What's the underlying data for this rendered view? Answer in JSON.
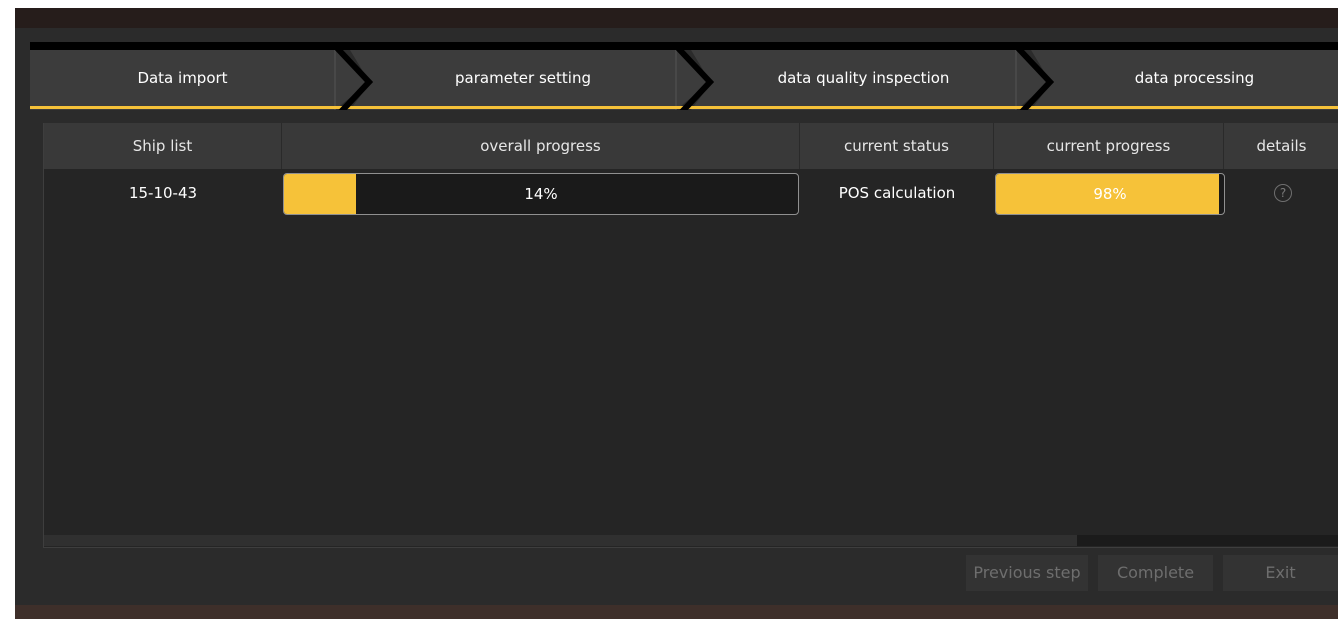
{
  "wizard": {
    "steps": [
      {
        "label": "Data import"
      },
      {
        "label": "parameter setting"
      },
      {
        "label": "data quality inspection"
      },
      {
        "label": "data processing"
      }
    ]
  },
  "table": {
    "headers": {
      "ship_list": "Ship list",
      "overall_progress": "overall progress",
      "current_status": "current status",
      "current_progress": "current progress",
      "details": "details"
    },
    "rows": [
      {
        "ship": "15-10-43",
        "overall_progress_text": "14%",
        "overall_progress_value": 14,
        "current_status": "POS calculation",
        "current_progress_text": "98%",
        "current_progress_value": 98,
        "details_icon": "help-circle-icon"
      }
    ]
  },
  "buttons": {
    "previous": "Previous step",
    "complete": "Complete",
    "exit": "Exit"
  },
  "colors": {
    "accent": "#f6c239",
    "background": "#2b2b2b",
    "header": "#393939"
  }
}
